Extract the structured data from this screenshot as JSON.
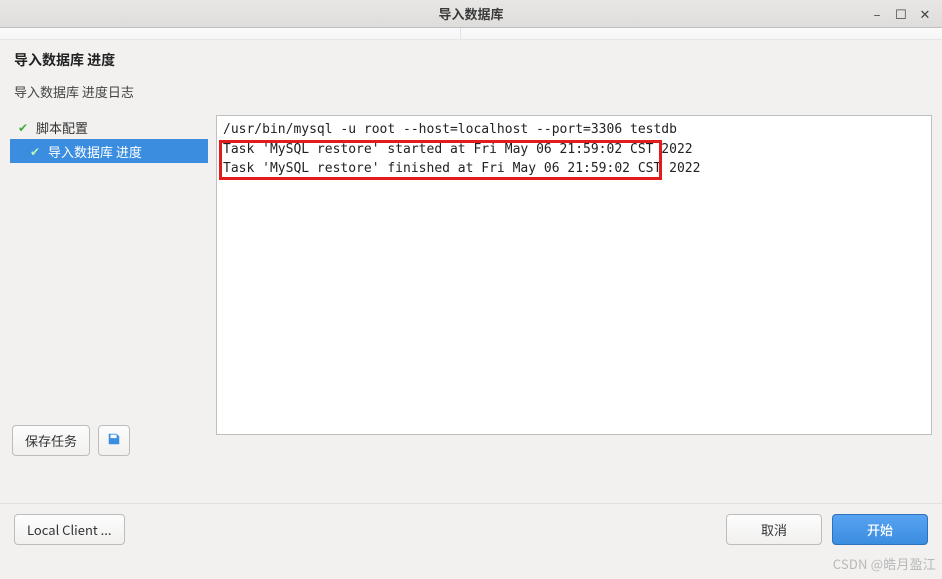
{
  "window": {
    "title": "导入数据库"
  },
  "header": {
    "title": "导入数据库 进度",
    "subtitle": "导入数据库 进度日志"
  },
  "sidebar": {
    "items": [
      {
        "label": "脚本配置",
        "selected": false
      },
      {
        "label": "导入数据库 进度",
        "selected": true
      }
    ],
    "save_button": "保存任务"
  },
  "log": {
    "lines": [
      "/usr/bin/mysql -u root --host=localhost --port=3306 testdb",
      "Task 'MySQL restore' started at Fri May 06 21:59:02 CST 2022",
      "Task 'MySQL restore' finished at Fri May 06 21:59:02 CST 2022"
    ]
  },
  "footer": {
    "local_client": "Local Client ...",
    "cancel": "取消",
    "start": "开始"
  },
  "watermark": "CSDN @皓月盈江"
}
